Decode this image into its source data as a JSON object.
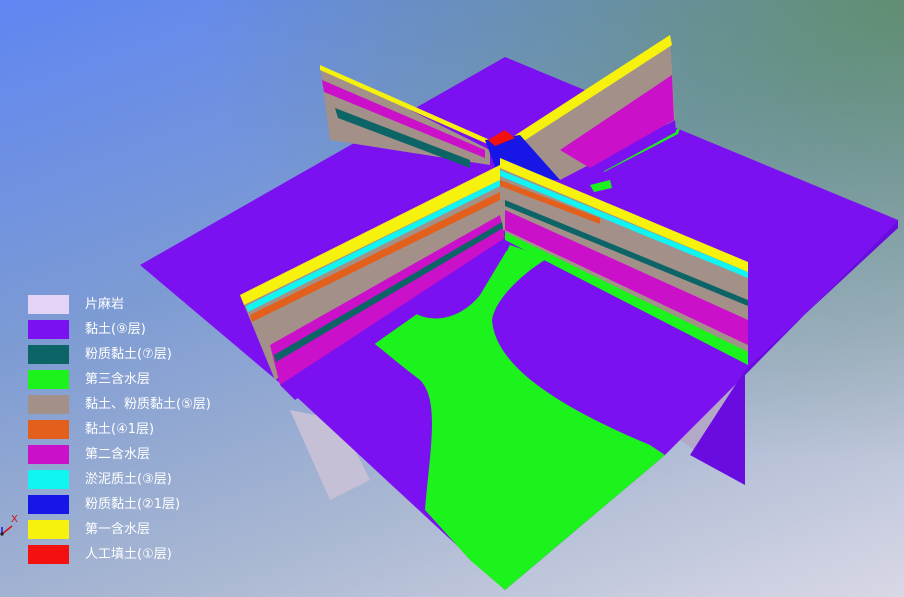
{
  "legend": {
    "items": [
      {
        "label": "片麻岩",
        "color": "#e3d3f6"
      },
      {
        "label": "黏土(⑨层)",
        "color": "#7b10f0"
      },
      {
        "label": "粉质黏土(⑦层)",
        "color": "#0d6467"
      },
      {
        "label": "第三含水层",
        "color": "#1cf21c"
      },
      {
        "label": "黏土、粉质黏土(⑤层)",
        "color": "#a39189"
      },
      {
        "label": "黏土(④1层)",
        "color": "#e2601c"
      },
      {
        "label": "第二含水层",
        "color": "#cb10c9"
      },
      {
        "label": "淤泥质土(③层)",
        "color": "#10f4f2"
      },
      {
        "label": "粉质黏土(②1层)",
        "color": "#1616e6"
      },
      {
        "label": "第一含水层",
        "color": "#f6f20d"
      },
      {
        "label": "人工填土(①层)",
        "color": "#f4100f"
      }
    ]
  },
  "axis": {
    "x_label": "X",
    "x_color": "#d01010"
  }
}
